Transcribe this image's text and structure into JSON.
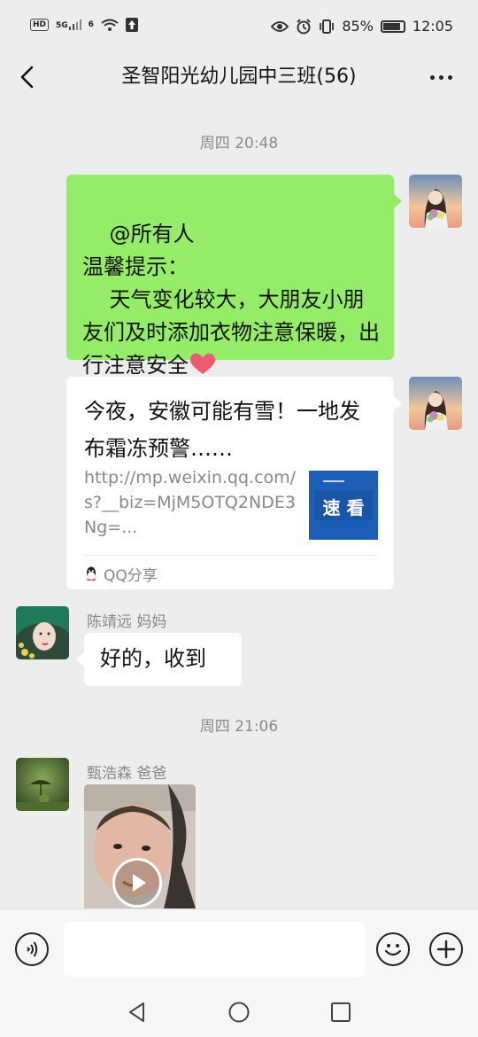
{
  "status_bar": {
    "hd": "HD",
    "net1": "5G",
    "net2": "6",
    "battery": "85%",
    "battery_level": 0.85,
    "time": "12:05"
  },
  "header": {
    "title": "圣智阳光幼儿园中三班(56)"
  },
  "timestamps": [
    "周四 20:48",
    "周四 21:06"
  ],
  "messages": {
    "m1": {
      "text": "@所有人\n温馨提示：\n    天气变化较大，大朋友小朋友们及时添加衣物注意保暖，出行注意安全"
    },
    "m2": {
      "title": "今夜，安徽可能有雪！一地发布霜冻预警……",
      "desc": "http://mp.weixin.qq.com/s?__biz=MjM5OTQ2NDE3Ng=...",
      "thumb_label": "速 看",
      "source": "QQ分享"
    },
    "m3": {
      "sender": "陈靖远 妈妈",
      "text": "好的，收到"
    },
    "m4": {
      "sender": "甄浩森  爸爸"
    }
  },
  "colors": {
    "bg": "#ededed",
    "self_bubble": "#95ec69",
    "other_bubble": "#ffffff"
  },
  "icons": [
    "back-arrow-icon",
    "more-icon",
    "heart-icon",
    "qq-icon",
    "play-icon",
    "voice-icon",
    "emoji-icon",
    "plus-icon",
    "nav-back-icon",
    "nav-home-icon",
    "nav-recent-icon"
  ]
}
